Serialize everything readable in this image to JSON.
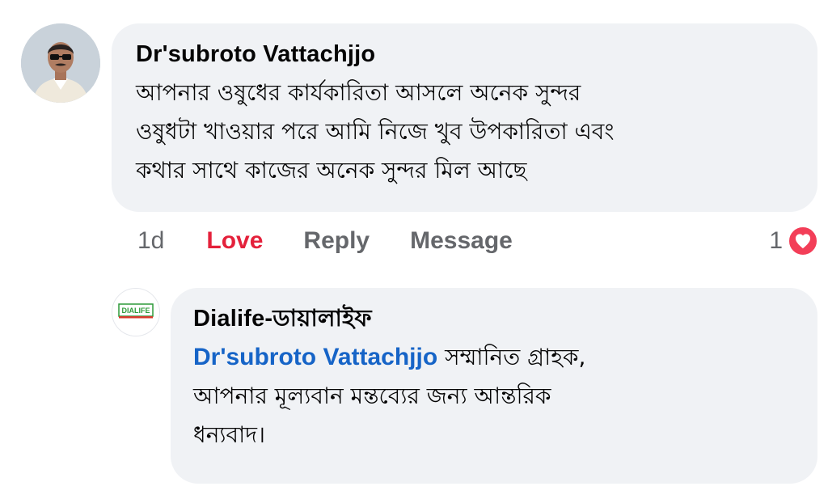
{
  "comment": {
    "author": "Dr'subroto Vattachjjo",
    "text_lines": [
      "আপনার ওষুধের কার্যকারিতা আসলে অনেক সুন্দর",
      "ওষুধটা খাওয়ার পরে আমি নিজে খুব উপকারিতা এবং",
      "কথার সাথে কাজের অনেক সুন্দর মিল আছে"
    ],
    "avatar_icon": "user-avatar-photo"
  },
  "actions": {
    "time": "1d",
    "love_label": "Love",
    "reply_label": "Reply",
    "message_label": "Message"
  },
  "reactions": {
    "count": "1",
    "icon": "heart-icon",
    "color": "#f33e58"
  },
  "reply": {
    "author": "Dialife-ডায়ালাইফ",
    "mention": "Dr'subroto Vattachjjo",
    "text_after_mention": " সম্মানিত গ্রাহক,",
    "text_lines": [
      "আপনার মূল্যবান মন্তব্যের জন্য আন্তরিক",
      "ধন্যবাদ।"
    ],
    "logo_text": "DIALIFE"
  },
  "colors": {
    "bubble": "#f0f2f5",
    "love": "#e4213b",
    "mention": "#1664c7",
    "secondary_text": "#65676b"
  }
}
